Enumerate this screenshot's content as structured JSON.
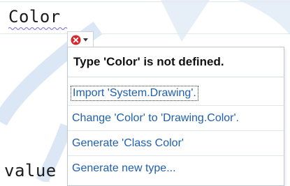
{
  "editor": {
    "line_top": "Color",
    "line_bottom": "value"
  },
  "smart_tag": {
    "icon": "error-icon",
    "dropdown_icon": "chevron-down-icon"
  },
  "popup": {
    "header": "Type 'Color' is not defined.",
    "items": [
      {
        "label": "Import 'System.Drawing'."
      },
      {
        "label": "Change 'Color' to 'Drawing.Color'."
      },
      {
        "label": "Generate 'Class Color'"
      },
      {
        "label": "Generate new type..."
      }
    ]
  },
  "colors": {
    "link": "#1e5fb0",
    "error": "#d9282c",
    "squiggle": "#8a7fd6",
    "watermark": "#cfe0f2"
  }
}
